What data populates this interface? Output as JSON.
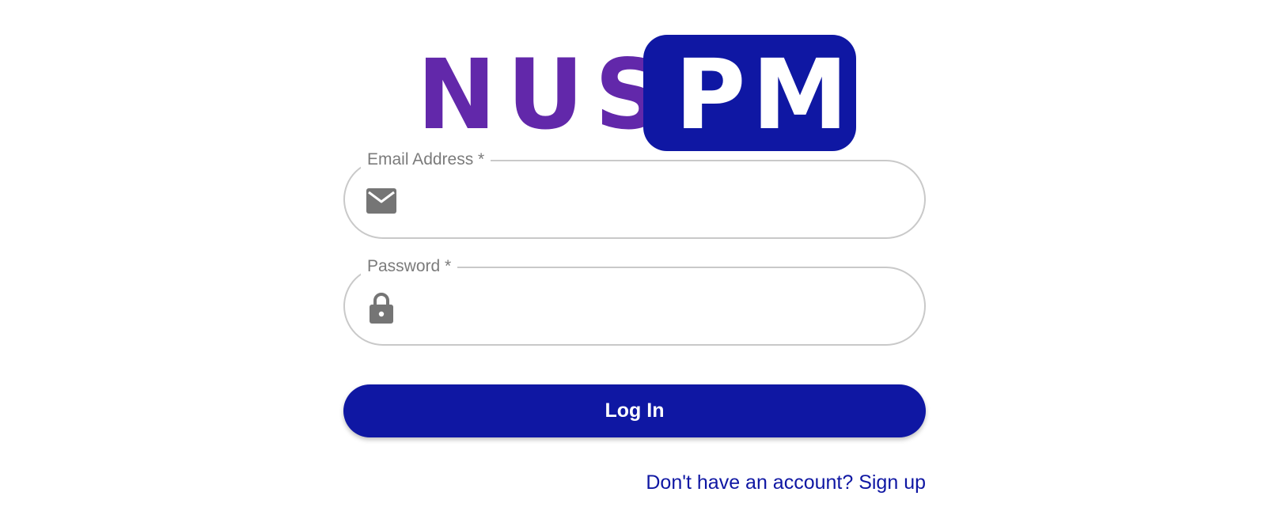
{
  "logo": {
    "left_text": "NUS",
    "right_text": "PM",
    "colors": {
      "left_text": "#6228aa",
      "badge_background": "#0f17a3",
      "badge_text": "#ffffff"
    }
  },
  "form": {
    "email": {
      "label": "Email Address *",
      "value": "",
      "icon": "mail-icon"
    },
    "password": {
      "label": "Password *",
      "value": "",
      "icon": "lock-icon"
    },
    "login_button_label": "Log In",
    "signup_link_text": "Don't have an account? Sign up"
  },
  "colors": {
    "accent": "#0f17a3",
    "field_border": "#c9c9c9",
    "label_text": "#7b7b7b",
    "icon": "#757575"
  }
}
